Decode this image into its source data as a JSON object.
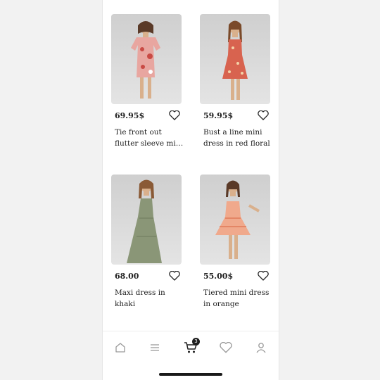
{
  "products": [
    {
      "price": "69.95$",
      "title": "Tie front out flutter sleeve mini dress",
      "dress_color": "#e8a6a0"
    },
    {
      "price": "59.95$",
      "title": "Bust a line mini dress in red floral",
      "dress_color": "#d8634f"
    },
    {
      "price": "68.00",
      "title": "Maxi dress in khaki",
      "dress_color": "#8a9677"
    },
    {
      "price": "55.00$",
      "title": "Tiered mini dress in orange",
      "dress_color": "#f0a98c"
    }
  ],
  "tabbar": {
    "items": [
      "home-icon",
      "menu-icon",
      "cart-icon",
      "heart-icon",
      "user-icon"
    ],
    "active": "cart-icon",
    "cart_count": "3"
  },
  "colors": {
    "background": "#ffffff",
    "icon": "#9a9a9a",
    "icon_active": "#1f1f1f",
    "text": "#222222"
  }
}
